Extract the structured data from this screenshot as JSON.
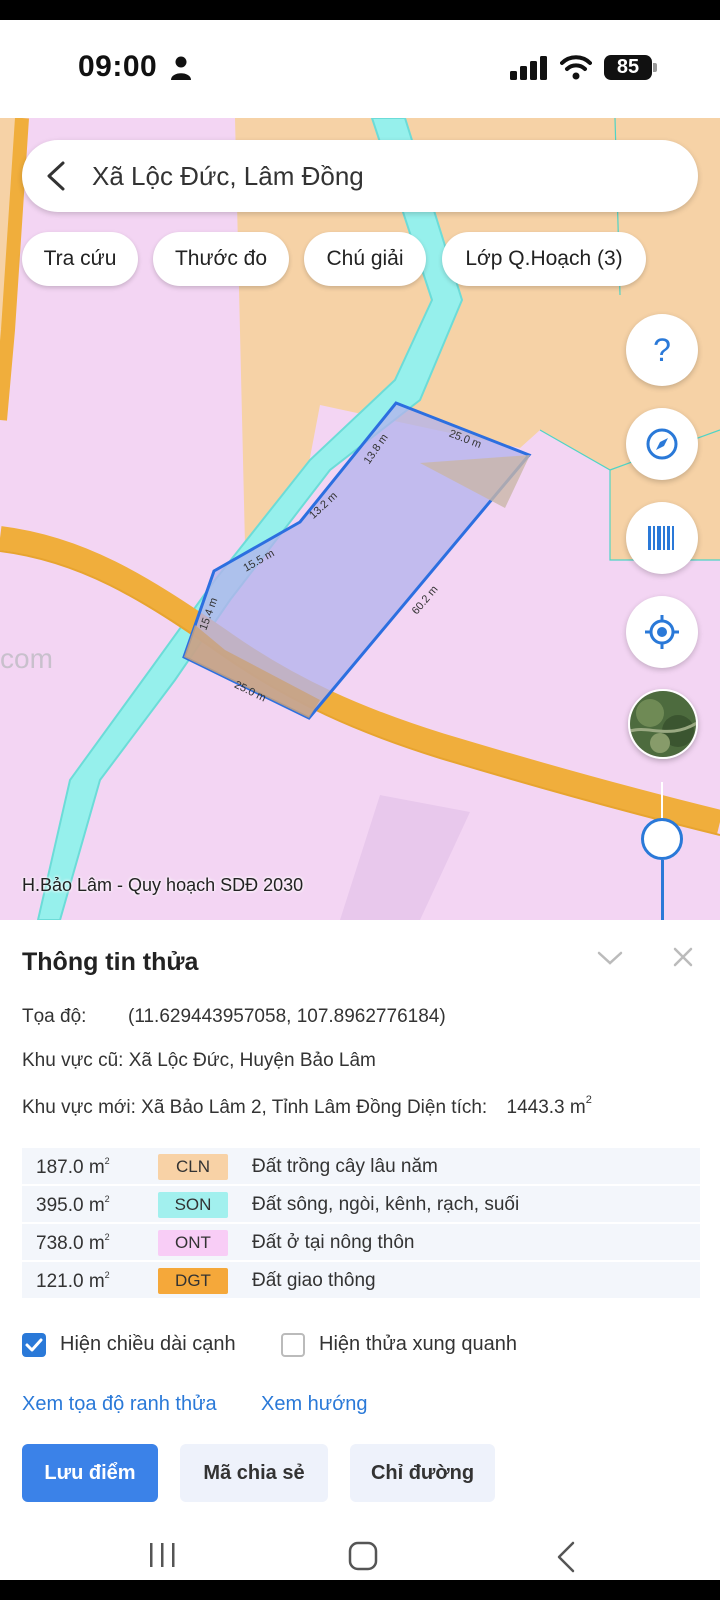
{
  "status_bar": {
    "time": "09:00",
    "battery": "85"
  },
  "search": {
    "text": "Xã Lộc Đức, Lâm Đồng"
  },
  "chips": [
    {
      "label": "Tra cứu"
    },
    {
      "label": "Thước đo"
    },
    {
      "label": "Chú giải"
    },
    {
      "label": "Lớp Q.Hoạch (3)"
    }
  ],
  "map": {
    "help_label": "?",
    "edge_labels": [
      "25.0 m",
      "60.2 m",
      "25.0 m",
      "15.4 m",
      "15.5 m",
      "13.2 m",
      "13.8 m"
    ],
    "watermark_left": "com",
    "caption": "H.Bảo Lâm - Quy hoạch SDĐ 2030",
    "colors": {
      "base_pink": "#f3d5f3",
      "orange_zone": "#f6d2a6",
      "river": "#96f0ec",
      "road": "#f0ae3c",
      "parcel_outline": "#2c6fe0",
      "parcel_fill": "#b4b4ec"
    }
  },
  "panel": {
    "title": "Thông tin thửa",
    "coord_label": "Tọa độ:",
    "coord_value": "(11.629443957058, 107.8962776184)",
    "old_area_label": "Khu vực cũ: Xã Lộc Đức, Huyện Bảo Lâm",
    "new_area_label": "Khu vực mới: Xã Bảo Lâm 2, Tỉnh Lâm Đồng Diện tích:",
    "total_area": "1443.3 m",
    "area_sup": "2",
    "land_rows": [
      {
        "area": "187.0 m",
        "code": "CLN",
        "name": "Đất trồng cây lâu năm",
        "color": "#f8d2a6"
      },
      {
        "area": "395.0 m",
        "code": "SON",
        "name": "Đất sông, ngòi, kênh, rạch, suối",
        "color": "#a2f0ee"
      },
      {
        "area": "738.0 m",
        "code": "ONT",
        "name": "Đất ở tại nông thôn",
        "color": "#f8cdf6"
      },
      {
        "area": "121.0 m",
        "code": "DGT",
        "name": "Đất giao thông",
        "color": "#f5a83a"
      }
    ],
    "show_edge_length": "Hiện chiều dài cạnh",
    "show_nearby": "Hiện thửa xung quanh",
    "link_coords": "Xem tọa độ ranh thửa",
    "link_direction": "Xem hướng",
    "btn_save": "Lưu điểm",
    "btn_share": "Mã chia sẻ",
    "btn_directions": "Chỉ đường"
  }
}
